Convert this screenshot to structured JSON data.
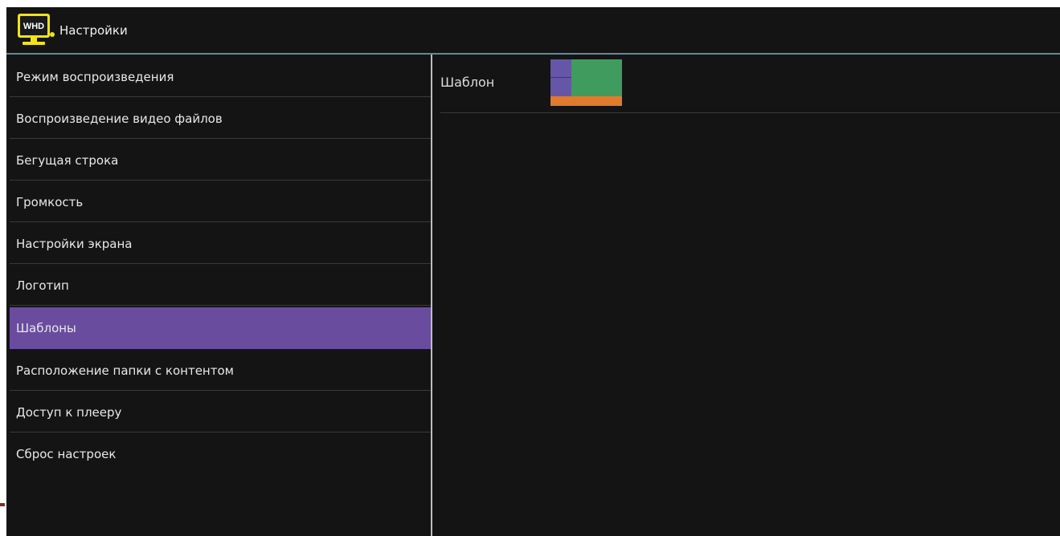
{
  "header": {
    "logo_text": "WHD",
    "title": "Настройки"
  },
  "sidebar": {
    "selected_index": 6,
    "items": [
      {
        "label": "Режим воспроизведения"
      },
      {
        "label": "Воспроизведение видео файлов"
      },
      {
        "label": "Бегущая строка"
      },
      {
        "label": "Громкость"
      },
      {
        "label": "Настройки экрана"
      },
      {
        "label": "Логотип"
      },
      {
        "label": "Шаблоны"
      },
      {
        "label": "Расположение папки с контентом"
      },
      {
        "label": "Доступ к плееру"
      },
      {
        "label": "Сброс настроек"
      }
    ]
  },
  "content": {
    "template_label": "Шаблон",
    "template_preview_colors": {
      "left_zones": "#6556a8",
      "main_zone": "#3f9c5e",
      "bottom_strip": "#e07a2c"
    }
  },
  "colors": {
    "background": "#141414",
    "selected": "#6a4c9f",
    "accent_line": "#5f8a9c",
    "logo_yellow": "#f2e21b"
  }
}
